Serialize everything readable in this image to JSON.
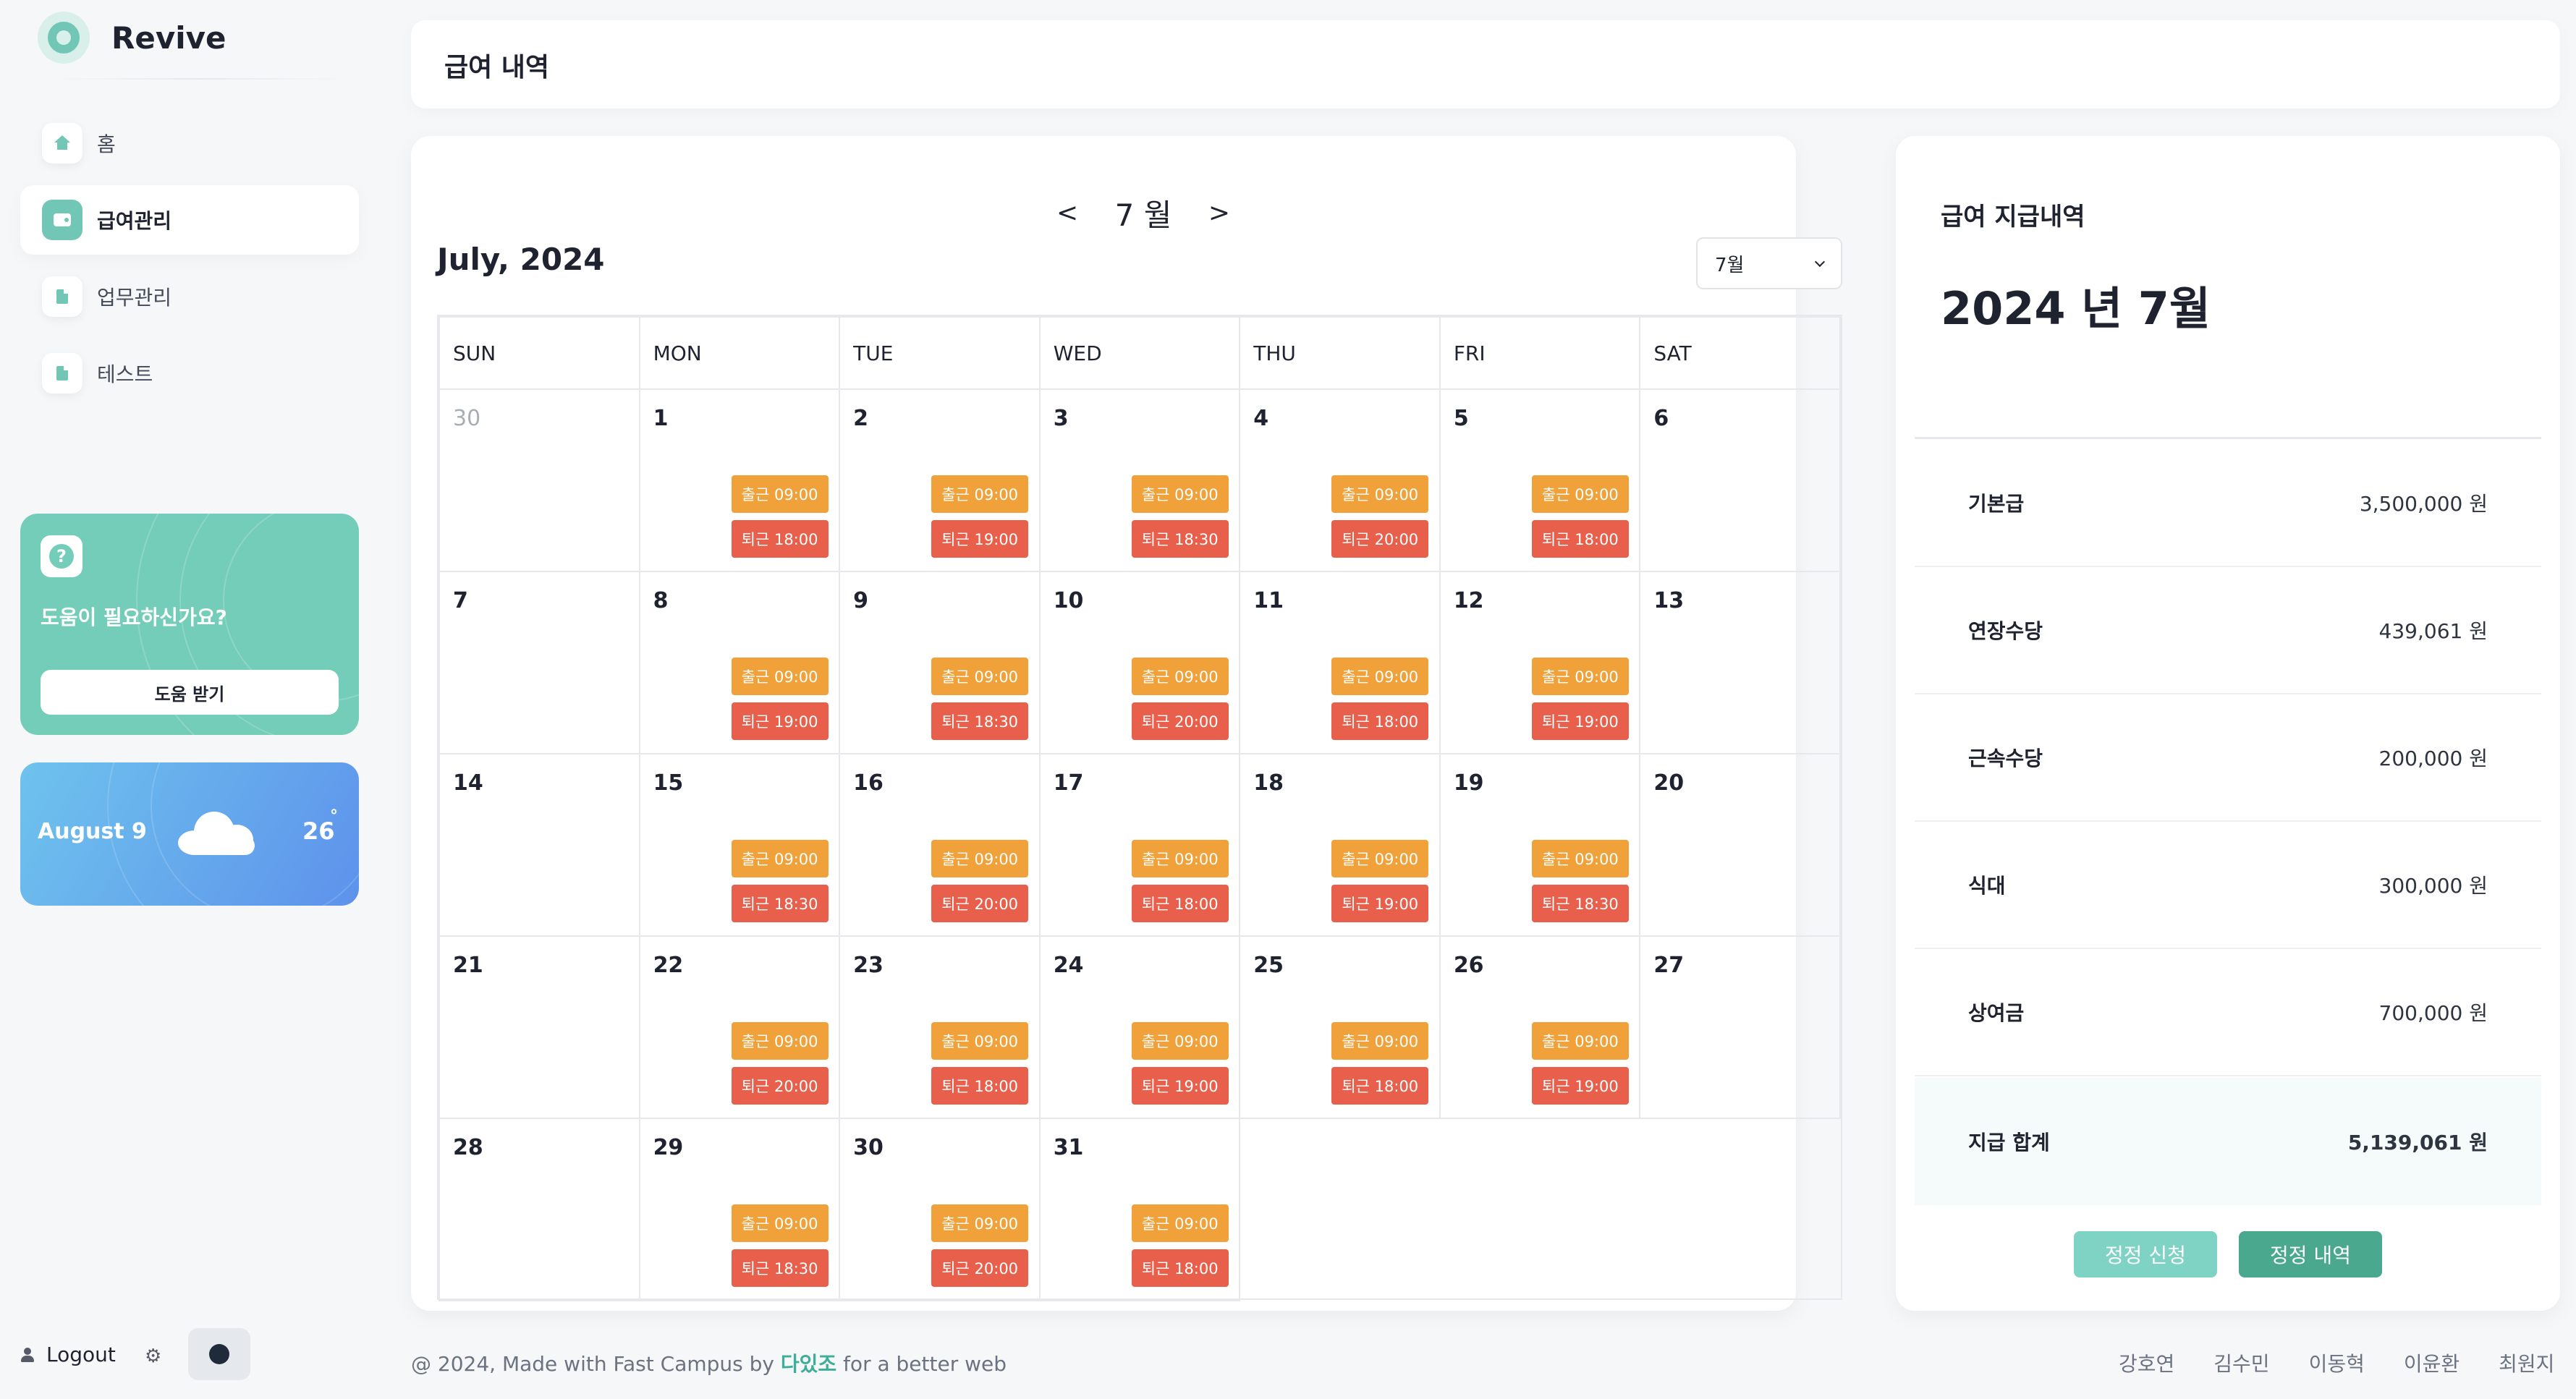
{
  "brand": {
    "name": "Revive"
  },
  "sidebar": {
    "items": [
      {
        "label": "홈",
        "icon": "home-icon",
        "active": false
      },
      {
        "label": "급여관리",
        "icon": "wallet-icon",
        "active": true
      },
      {
        "label": "업무관리",
        "icon": "document-icon",
        "active": false
      },
      {
        "label": "테스트",
        "icon": "document-icon",
        "active": false
      }
    ],
    "help": {
      "title": "도움이 필요하신가요?",
      "button": "도움 받기",
      "icon": "question-icon"
    },
    "weather": {
      "date": "August 9",
      "temp": "26",
      "unit": "°",
      "icon": "cloud-icon"
    },
    "logout": "Logout"
  },
  "page": {
    "title": "급여 내역"
  },
  "calendar": {
    "nav": {
      "prev": "<",
      "month": "7 월",
      "next": ">"
    },
    "title": "July, 2024",
    "select_value": "7월",
    "weekdays": [
      "SUN",
      "MON",
      "TUE",
      "WED",
      "THU",
      "FRI",
      "SAT"
    ],
    "weeks": [
      [
        {
          "day": "30",
          "muted": true
        },
        {
          "day": "1",
          "in": "출근 09:00",
          "out": "퇴근 18:00"
        },
        {
          "day": "2",
          "in": "출근 09:00",
          "out": "퇴근 19:00"
        },
        {
          "day": "3",
          "in": "출근 09:00",
          "out": "퇴근 18:30"
        },
        {
          "day": "4",
          "in": "출근 09:00",
          "out": "퇴근 20:00"
        },
        {
          "day": "5",
          "in": "출근 09:00",
          "out": "퇴근 18:00"
        },
        {
          "day": "6"
        }
      ],
      [
        {
          "day": "7"
        },
        {
          "day": "8",
          "in": "출근 09:00",
          "out": "퇴근 19:00"
        },
        {
          "day": "9",
          "in": "출근 09:00",
          "out": "퇴근 18:30"
        },
        {
          "day": "10",
          "in": "출근 09:00",
          "out": "퇴근 20:00"
        },
        {
          "day": "11",
          "in": "출근 09:00",
          "out": "퇴근 18:00"
        },
        {
          "day": "12",
          "in": "출근 09:00",
          "out": "퇴근 19:00"
        },
        {
          "day": "13"
        }
      ],
      [
        {
          "day": "14"
        },
        {
          "day": "15",
          "in": "출근 09:00",
          "out": "퇴근 18:30"
        },
        {
          "day": "16",
          "in": "출근 09:00",
          "out": "퇴근 20:00"
        },
        {
          "day": "17",
          "in": "출근 09:00",
          "out": "퇴근 18:00"
        },
        {
          "day": "18",
          "in": "출근 09:00",
          "out": "퇴근 19:00"
        },
        {
          "day": "19",
          "in": "출근 09:00",
          "out": "퇴근 18:30"
        },
        {
          "day": "20"
        }
      ],
      [
        {
          "day": "21"
        },
        {
          "day": "22",
          "in": "출근 09:00",
          "out": "퇴근 20:00"
        },
        {
          "day": "23",
          "in": "출근 09:00",
          "out": "퇴근 18:00"
        },
        {
          "day": "24",
          "in": "출근 09:00",
          "out": "퇴근 19:00"
        },
        {
          "day": "25",
          "in": "출근 09:00",
          "out": "퇴근 18:00"
        },
        {
          "day": "26",
          "in": "출근 09:00",
          "out": "퇴근 19:00"
        },
        {
          "day": "27"
        }
      ],
      [
        {
          "day": "28"
        },
        {
          "day": "29",
          "in": "출근 09:00",
          "out": "퇴근 18:30"
        },
        {
          "day": "30",
          "in": "출근 09:00",
          "out": "퇴근 20:00"
        },
        {
          "day": "31",
          "in": "출근 09:00",
          "out": "퇴근 18:00"
        },
        {
          "empty": true
        },
        {
          "empty": true
        },
        {
          "empty": true
        }
      ]
    ]
  },
  "pay": {
    "heading": "급여 지급내역",
    "month": "2024 년 7월",
    "rows": [
      {
        "label": "기본급",
        "value": "3,500,000 원"
      },
      {
        "label": "연장수당",
        "value": "439,061 원"
      },
      {
        "label": "근속수당",
        "value": "200,000 원"
      },
      {
        "label": "식대",
        "value": "300,000 원"
      },
      {
        "label": "상여금",
        "value": "700,000 원"
      }
    ],
    "total": {
      "label": "지급 합계",
      "value": "5,139,061 원"
    },
    "buttons": {
      "request": "정정 신청",
      "history": "정정 내역"
    }
  },
  "footer": {
    "prefix": "@ 2024, Made with Fast Campus by",
    "team": "다있조",
    "suffix": "for a better web",
    "links": [
      "강호연",
      "김수민",
      "이동혁",
      "이윤환",
      "최원지"
    ]
  },
  "colors": {
    "accent": "#72c6b5",
    "clock_in": "#f0a13a",
    "clock_out": "#e8604c",
    "weather": "#5e92ec"
  }
}
